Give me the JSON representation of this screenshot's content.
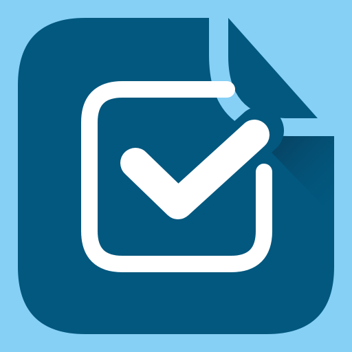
{
  "icon": {
    "name": "checklist-app-icon",
    "symbol": "checkbox-checked-icon",
    "colors": {
      "background": "#86CFF5",
      "tile": "#02587F",
      "checkbox": "#FFFFFF",
      "page_curl": "#86CFF5",
      "curl_shadow": "#0A3550"
    }
  }
}
